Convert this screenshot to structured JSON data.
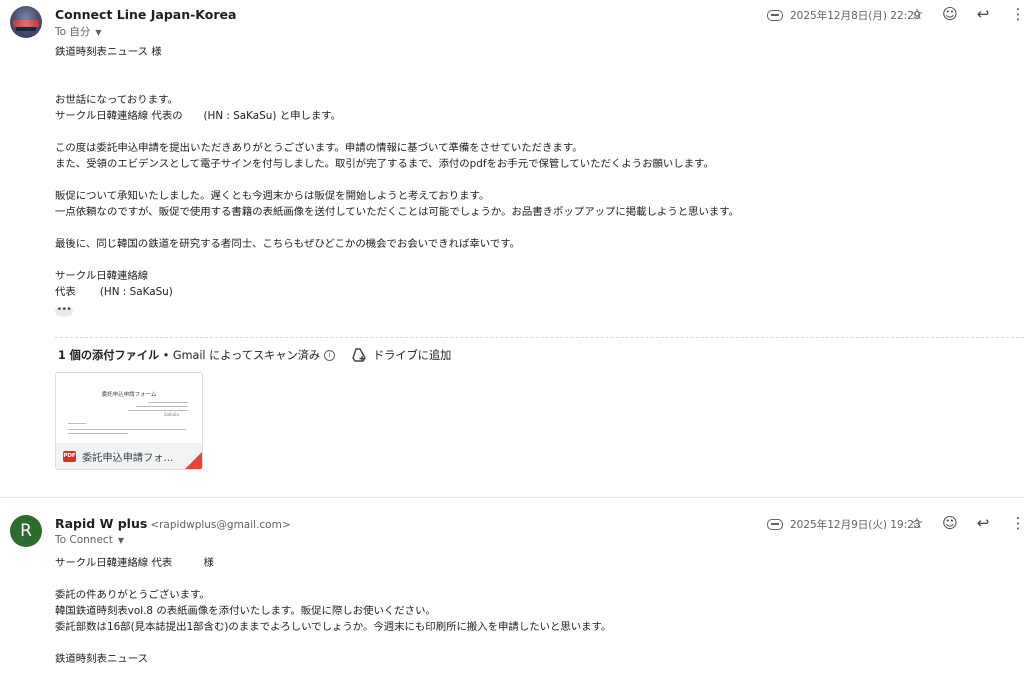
{
  "messages": [
    {
      "sender_name": "Connect Line Japan-Korea",
      "sender_email": "",
      "recipient": "To 自分",
      "date": "2025年12月8日(月) 22:29",
      "avatar_icon": "profile-photo",
      "body": "鉄道時刻表ニュース 様\n\n\nお世話になっております。\nサークル日韓連絡線 代表の　　(HN : SaKaSu) と申します。\n\nこの度は委託申込申請を提出いただきありがとうございます。申請の情報に基づいて準備をさせていただきます。\nまた、受領のエビデンスとして電子サインを付与しました。取引が完了するまで、添付のpdfをお手元で保管していただくようお願いします。\n\n販促について承知いたしました。遅くとも今週末からは販促を開始しようと考えております。\n一点依頼なのですが、販促で使用する書籍の表紙画像を送付していただくことは可能でしょうか。お品書きポップアップに掲載しようと思います。\n\n最後に、同じ韓国の鉄道を研究する者同士、こちらもぜひどこかの機会でお会いできれば幸いです。\n\nサークル日韓連絡線\n代表　　 (HN : SaKaSu)",
      "ellipsis": "•••",
      "attachments_header": "1 個の添付ファイル",
      "scan_text": "Gmail によってスキャン済み",
      "drive_button": "ドライブに追加",
      "attachment": {
        "name": "委託申込申請フォ...",
        "type": "PDF",
        "preview_title": "委託申込申請フォーム",
        "preview_sign": "SaKaSu"
      }
    },
    {
      "sender_name": "Rapid W plus",
      "sender_email": "<rapidwplus@gmail.com>",
      "recipient": "To Connect",
      "date": "2025年12月9日(火) 19:23",
      "avatar_letter": "R",
      "avatar_color": "#2e6b2e",
      "body": "サークル日韓連絡線 代表　　　様\n\n委託の件ありがとうございます。\n韓国鉄道時刻表vol.8 の表紙画像を添付いたします。販促に際しお使いください。\n委託部数は16部(見本誌提出1部含む)のままでよろしいでしょうか。今週末にも印刷所に搬入を申請したいと思います。\n\n鉄道時刻表ニュース"
    }
  ],
  "icons": {
    "label": "label-icon",
    "star": "☆",
    "emoji": "☺",
    "reply": "↩",
    "more": "⋮",
    "caret": "▼",
    "info": "i"
  }
}
